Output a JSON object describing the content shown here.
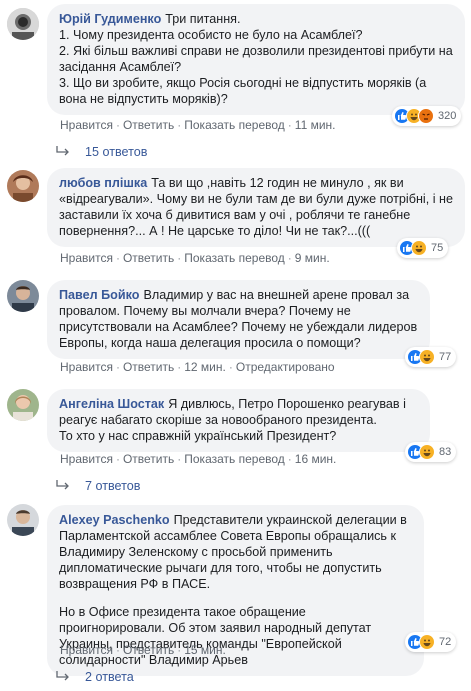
{
  "comments": [
    {
      "author": "Юрій Гудименко",
      "paragraphs": [
        "Три питання.\n1. Чому президента особисто не було на Асамблеї?\n2. Які більш важливі справи не дозволили президентові прибути на засідання Асамблеї?\n3. Що ви зробите, якщо Росія сьогодні не відпустить моряків (а вона не відпустить моряків)?"
      ],
      "like": "Нравится",
      "reply": "Ответить",
      "translate": "Показать перевод",
      "time": "11 мин.",
      "reaction_count": "320",
      "reactions": [
        "like",
        "haha",
        "angry"
      ],
      "replies": "15 ответов"
    },
    {
      "author": "любов плішка",
      "paragraphs": [
        "Та ви що ,навіть 12 годин не минуло , як ви «відреагували». Чому ви не були там де ви були дуже потрібні, і не заставили їх хоча б дивитися вам у очі , роблячи те ганебне повернення?... А ! Не царське то діло! Чи не так?...((("
      ],
      "like": "Нравится",
      "reply": "Ответить",
      "translate": "Показать перевод",
      "time": "9 мин.",
      "reaction_count": "75",
      "reactions": [
        "like",
        "haha"
      ]
    },
    {
      "author": "Павел Бойко",
      "paragraphs": [
        "Владимир у вас на внешней арене провал за провалом. Почему вы молчали вчера? Почему не присутствовали на Асамблее? Почему не убеждали лидеров Европы, когда наша делегация просила о помощи?"
      ],
      "like": "Нравится",
      "reply": "Ответить",
      "translate": "",
      "time": "12 мин.",
      "edited": "Отредактировано",
      "reaction_count": "77",
      "reactions": [
        "like",
        "haha"
      ]
    },
    {
      "author": "Ангеліна Шостак",
      "paragraphs": [
        "Я дивлюсь, Петро Порошенко реагував і реагує набагато скоріше за новообраного президента.\nТо хто у нас справжній український Президент?"
      ],
      "like": "Нравится",
      "reply": "Ответить",
      "translate": "Показать перевод",
      "time": "16 мин.",
      "reaction_count": "83",
      "reactions": [
        "like",
        "haha"
      ],
      "replies": "7 ответов"
    },
    {
      "author": "Alexey Paschenko",
      "paragraphs": [
        "Представители украинской делегации в Парламентской ассамблее Совета Европы обращались к Владимиру Зеленскому с просьбой применить дипломатические рычаги для того, чтобы не допустить возвращения РФ в ПАСЕ.",
        "Но в Офисе президента такое обращение проигнорировали. Об этом заявил народный депутат Украины, представитель команды \"Европейской солидарности\" Владимир Арьев"
      ],
      "like": "Нравится",
      "reply": "Ответить",
      "translate": "",
      "time": "15 мин.",
      "reaction_count": "72",
      "reactions": [
        "like",
        "haha"
      ],
      "replies": "2 ответа"
    }
  ],
  "colors": {
    "link": "#385898",
    "bubble": "#f2f3f5",
    "meta": "#606770",
    "like": "#1877f2",
    "haha": "#f7b125",
    "angry": "#e9710f"
  }
}
